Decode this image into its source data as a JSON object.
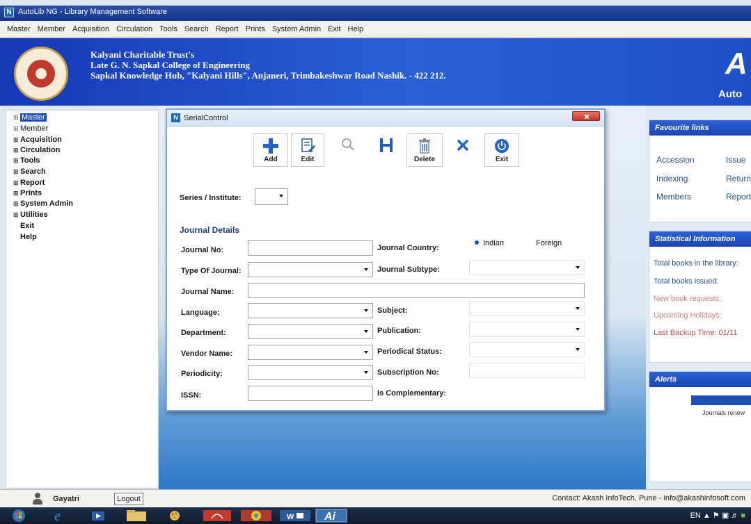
{
  "window": {
    "title": "AutoLib NG - Library Management Software"
  },
  "menubar": [
    "Master",
    "Member",
    "Acquisition",
    "Circulation",
    "Tools",
    "Search",
    "Report",
    "Prints",
    "System Admin",
    "Exit",
    "Help"
  ],
  "header": {
    "line1": "Kalyani Charitable Trust's",
    "line2": "Late G. N. Sapkal College of Engineering",
    "line3": "Sapkal Knowledge Hub, \"Kalyani Hills\", Anjaneri, Trimbakeshwar Road Nashik. - 422 212.",
    "brand": "Auto"
  },
  "leftnav": {
    "items": [
      {
        "label": "Master",
        "bold": false,
        "selected": true
      },
      {
        "label": "Member",
        "bold": false,
        "selected": false
      },
      {
        "label": "Acquisition",
        "bold": true,
        "selected": false
      },
      {
        "label": "Circulation",
        "bold": true,
        "selected": false
      },
      {
        "label": "Tools",
        "bold": true,
        "selected": false
      },
      {
        "label": "Search",
        "bold": true,
        "selected": false
      },
      {
        "label": "Report",
        "bold": true,
        "selected": false
      },
      {
        "label": "Prints",
        "bold": true,
        "selected": false
      },
      {
        "label": "System Admin",
        "bold": true,
        "selected": false
      },
      {
        "label": "Utilities",
        "bold": true,
        "selected": false
      },
      {
        "label": "Exit",
        "bold": true,
        "selected": false
      },
      {
        "label": "Help",
        "bold": true,
        "selected": false
      }
    ]
  },
  "dialog": {
    "title": "SerialControl",
    "toolbar": {
      "add": "Add",
      "edit": "Edit",
      "delete": "Delete",
      "exit": "Exit"
    },
    "series_label": "Series / Institute:",
    "section": "Journal Details",
    "labels": {
      "journal_no": "Journal No:",
      "type_of_journal": "Type Of Journal:",
      "journal_name": "Journal Name:",
      "language": "Language:",
      "department": "Department:",
      "vendor_name": "Vendor Name:",
      "periodicity": "Periodicity:",
      "issn": "ISSN:",
      "journal_country": "Journal Country:",
      "journal_subtype": "Journal Subtype:",
      "subject": "Subject:",
      "publication": "Publication:",
      "periodical_status": "Periodical Status:",
      "subscription_no": "Subscription No:",
      "is_complementary": "Is Complementary:"
    },
    "country_options": {
      "indian": "Indian",
      "foreign": "Foreign",
      "selected": "Indian"
    }
  },
  "rightpanel": {
    "favourite": {
      "title": "Favourite links",
      "links": [
        "Accession",
        "Issue",
        "Indexing",
        "Return",
        "Members",
        "Report"
      ]
    },
    "stats": {
      "title": "Statistical Information",
      "rows": [
        "Total books in the library:",
        "Total books issued:",
        "New book requests:",
        "Upcoming Holidays:",
        "Last Backup Time: 01/11"
      ]
    },
    "alerts": {
      "title": "Alerts",
      "row": "Journals renew"
    }
  },
  "statusbar": {
    "user": "Gayatri",
    "logout": "Logout",
    "contact": "Contact: Akash InfoTech, Pune - info@akashinfosoft.com"
  },
  "taskbar": {
    "tray": "EN"
  },
  "colors": {
    "accent": "#1a4fb8",
    "header": "#1f4fc8",
    "dialog_border": "#7aa7d6"
  }
}
